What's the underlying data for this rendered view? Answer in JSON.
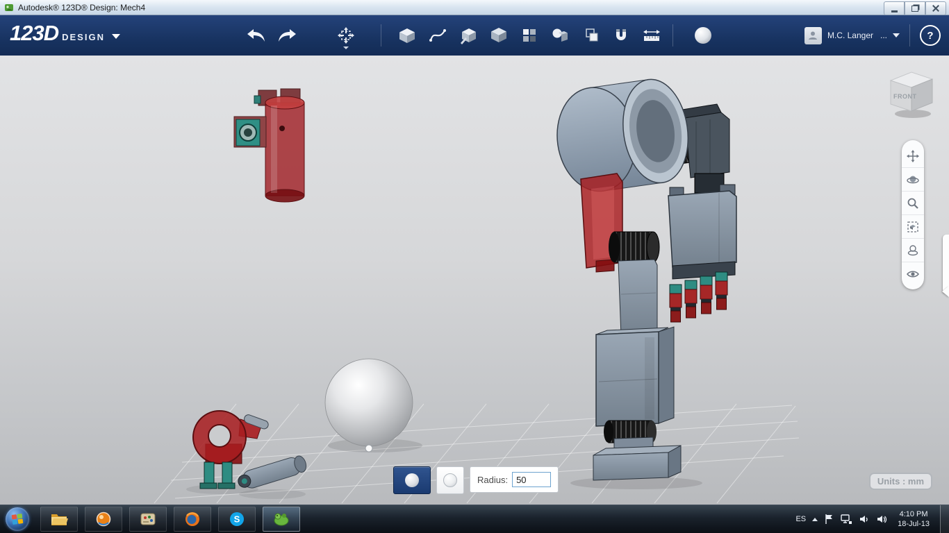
{
  "window": {
    "title": "Autodesk® 123D® Design: Mech4"
  },
  "toolbar": {
    "logo_main": "123D",
    "logo_sub": "DESIGN",
    "user_name": "M.C. Langer",
    "user_ellipsis": "...",
    "help_label": "?"
  },
  "viewport": {
    "viewcube_label": "FRONT",
    "units_label": "Units : mm"
  },
  "sphere_dialog": {
    "radius_label": "Radius:",
    "radius_value": "50"
  },
  "taskbar": {
    "language": "ES",
    "skype_letter": "S",
    "time": "4:10 PM",
    "date": "18-Jul-13"
  },
  "colors": {
    "toolbar_bg": "#1b3668",
    "selected_tool_bg": "#24477e",
    "model_red": "#a52125",
    "model_teal": "#2e8c82",
    "model_steel": "#8e9dae"
  }
}
